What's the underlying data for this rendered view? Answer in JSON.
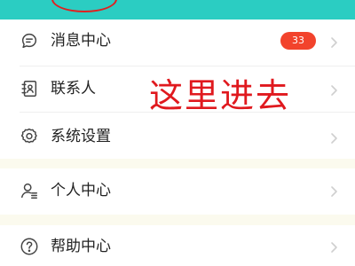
{
  "menu": {
    "messages_label": "消息中心",
    "messages_badge": "33",
    "contacts_label": "联系人",
    "settings_label": "系统设置",
    "personal_label": "个人中心",
    "help_label": "帮助中心"
  },
  "annotation": {
    "text": "这里进去",
    "color": "#e0191e"
  },
  "colors": {
    "header": "#2bcdc2",
    "badge": "#f2432c",
    "page_background": "#fbfaee"
  },
  "icons": [
    "chat-bubble-icon",
    "contact-card-icon",
    "gear-icon",
    "person-icon",
    "help-circle-icon",
    "chevron-right-icon"
  ]
}
